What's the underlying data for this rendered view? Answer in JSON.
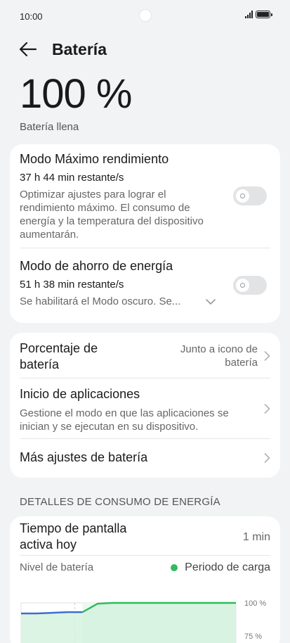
{
  "status_bar": {
    "time": "10:00"
  },
  "header": {
    "title": "Batería"
  },
  "battery": {
    "percent_label": "100 %",
    "level": 100,
    "state": "Batería llena"
  },
  "modes": {
    "max_performance": {
      "title": "Modo Máximo rendimiento",
      "remaining": "37 h 44 min restante/s",
      "description": "Optimizar ajustes para lograr el rendimiento máximo. El consumo de energía y la temperatura del dispositivo aumentarán.",
      "enabled": false
    },
    "power_saving": {
      "title": "Modo de ahorro de energía",
      "remaining": "51 h 38 min restante/s",
      "description": "Se habilitará el Modo oscuro. Se...",
      "enabled": false
    }
  },
  "settings": {
    "percentage": {
      "title": "Porcentaje de batería",
      "value": "Junto a icono de batería"
    },
    "app_launch": {
      "title": "Inicio de aplicaciones",
      "description": "Gestione el modo en que las aplicaciones se inician y se ejecutan en su dispositivo."
    },
    "more": {
      "title": "Más ajustes de batería"
    }
  },
  "consumption": {
    "section_title": "DETALLES DE CONSUMO DE ENERGÍA",
    "screen_time_label": "Tiempo de pantalla activa hoy",
    "screen_time_value": "1 min",
    "chart_label": "Nivel de batería",
    "legend_charging": "Periodo de carga"
  },
  "colors": {
    "accent_charge": "#2fbb5e",
    "line_blue": "#3b6fd1",
    "charge_fill": "#d6f2df"
  },
  "icons": {
    "back": "arrow-left-icon",
    "chevron": "chevron-right-icon",
    "expand": "chevron-down-icon"
  },
  "chart_data": {
    "type": "line",
    "title": "",
    "xlabel": "",
    "ylabel": "",
    "ylim": [
      75,
      100
    ],
    "y_tick_labels": [
      "100 %",
      "75 %"
    ],
    "x": [
      0,
      1,
      2,
      3,
      4,
      5,
      6,
      7,
      8,
      9,
      10,
      11,
      12,
      13,
      14
    ],
    "series": [
      {
        "values": [
          92,
          92,
          92.5,
          93,
          93,
          99.5,
          100,
          100,
          100,
          100,
          100,
          100,
          100,
          100,
          100
        ]
      }
    ],
    "charging_period": [
      4,
      14
    ],
    "grid": true
  }
}
